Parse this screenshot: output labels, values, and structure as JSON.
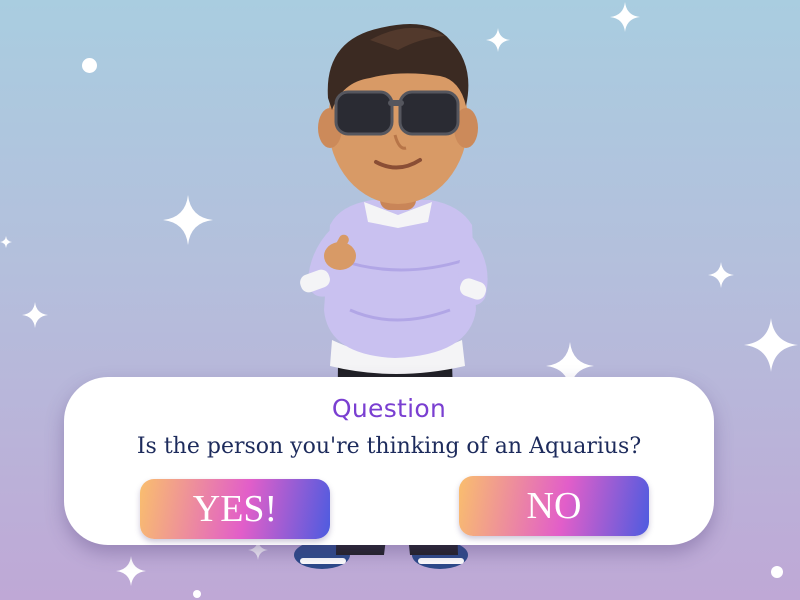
{
  "dialog": {
    "title": "Question",
    "question": "Is the person you're thinking of an Aquarius?",
    "yes_label": "YES!",
    "no_label": "NO"
  },
  "colors": {
    "title": "#7a3fd1",
    "question_text": "#1d2b5c",
    "button_gradient_start": "#f9be6e",
    "button_gradient_mid": "#e25ec9",
    "button_gradient_end": "#4d5ce0",
    "background_top": "#a9cde0",
    "background_bottom": "#bfa8d6"
  },
  "icons": [
    "sparkle-icon",
    "star-dot"
  ]
}
